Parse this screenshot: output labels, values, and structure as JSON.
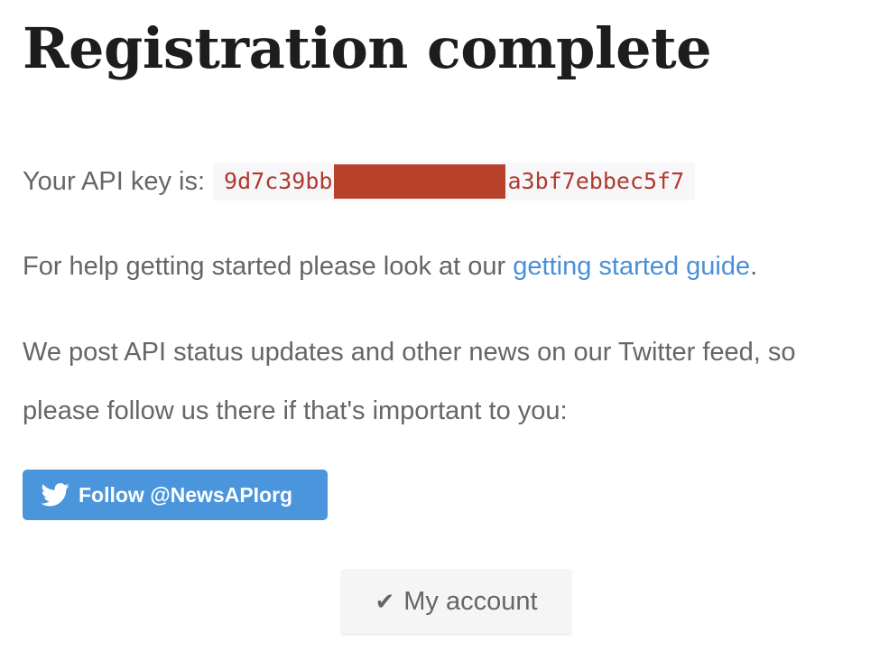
{
  "page": {
    "title": "Registration complete"
  },
  "api_key": {
    "label": "Your API key is:",
    "prefix": "9d7c39bb",
    "suffix": "a3bf7ebbec5f7",
    "redaction_color": "#b8412c",
    "code_color": "#b03a2e"
  },
  "help": {
    "text_before": "For help getting started please look at our ",
    "link_text": "getting started guide",
    "text_after": "."
  },
  "news": {
    "line1": "We post API status updates and other news on our Twitter feed, so",
    "line2": "please follow us there if that's important to you:"
  },
  "twitter_button": {
    "icon": "twitter-bird-icon",
    "label": "Follow @NewsAPIorg",
    "color": "#4a95dc"
  },
  "account_button": {
    "icon": "checkmark-icon",
    "label": "My account"
  }
}
